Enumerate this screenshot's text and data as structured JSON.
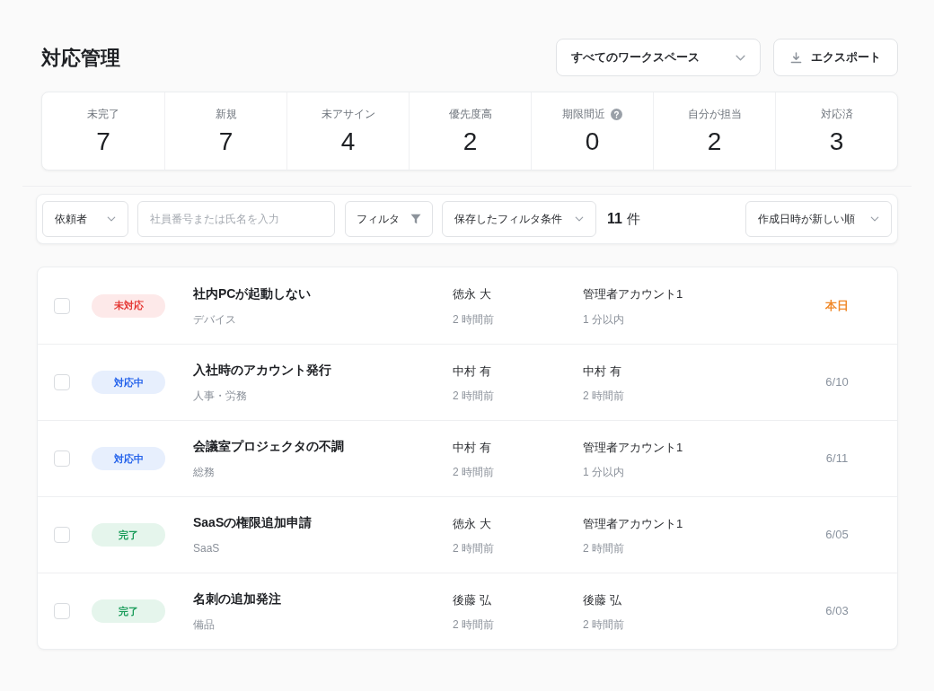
{
  "header": {
    "title": "対応管理",
    "workspace_select": {
      "value": "すべてのワークスペース"
    },
    "export_button": {
      "label": "エクスポート"
    }
  },
  "stats": [
    {
      "label": "未完了",
      "value": "7",
      "help": false
    },
    {
      "label": "新規",
      "value": "7",
      "help": false
    },
    {
      "label": "未アサイン",
      "value": "4",
      "help": false
    },
    {
      "label": "優先度高",
      "value": "2",
      "help": false
    },
    {
      "label": "期限間近",
      "value": "0",
      "help": true
    },
    {
      "label": "自分が担当",
      "value": "2",
      "help": false
    },
    {
      "label": "対応済",
      "value": "3",
      "help": false
    }
  ],
  "filters": {
    "requester_select": {
      "value": "依頼者"
    },
    "search": {
      "placeholder": "社員番号または氏名を入力"
    },
    "filter_button": {
      "label": "フィルタ"
    },
    "saved_filters": {
      "value": "保存したフィルタ条件"
    },
    "count": "11",
    "count_unit": "件",
    "sort_select": {
      "value": "作成日時が新しい順"
    }
  },
  "tickets": [
    {
      "checked": false,
      "status": {
        "label": "未対応",
        "kind": "open"
      },
      "title": "社内PCが起動しない",
      "category": "デバイス",
      "requester": {
        "name": "徳永 大",
        "time": "2 時間前"
      },
      "assignee": {
        "name": "管理者アカウント1",
        "time": "1 分以内"
      },
      "due": {
        "text": "本日",
        "urgent": true
      }
    },
    {
      "checked": false,
      "status": {
        "label": "対応中",
        "kind": "in_progress"
      },
      "title": "入社時のアカウント発行",
      "category": "人事・労務",
      "requester": {
        "name": "中村 有",
        "time": "2 時間前"
      },
      "assignee": {
        "name": "中村 有",
        "time": "2 時間前"
      },
      "due": {
        "text": "6/10",
        "urgent": false
      }
    },
    {
      "checked": false,
      "status": {
        "label": "対応中",
        "kind": "in_progress"
      },
      "title": "会議室プロジェクタの不調",
      "category": "総務",
      "requester": {
        "name": "中村 有",
        "time": "2 時間前"
      },
      "assignee": {
        "name": "管理者アカウント1",
        "time": "1 分以内"
      },
      "due": {
        "text": "6/11",
        "urgent": false
      }
    },
    {
      "checked": false,
      "status": {
        "label": "完了",
        "kind": "done"
      },
      "title": "SaaSの権限追加申請",
      "category": "SaaS",
      "requester": {
        "name": "徳永 大",
        "time": "2 時間前"
      },
      "assignee": {
        "name": "管理者アカウント1",
        "time": "2 時間前"
      },
      "due": {
        "text": "6/05",
        "urgent": false
      }
    },
    {
      "checked": false,
      "status": {
        "label": "完了",
        "kind": "done"
      },
      "title": "名刺の追加発注",
      "category": "備品",
      "requester": {
        "name": "後藤 弘",
        "time": "2 時間前"
      },
      "assignee": {
        "name": "後藤 弘",
        "time": "2 時間前"
      },
      "due": {
        "text": "6/03",
        "urgent": false
      }
    }
  ]
}
